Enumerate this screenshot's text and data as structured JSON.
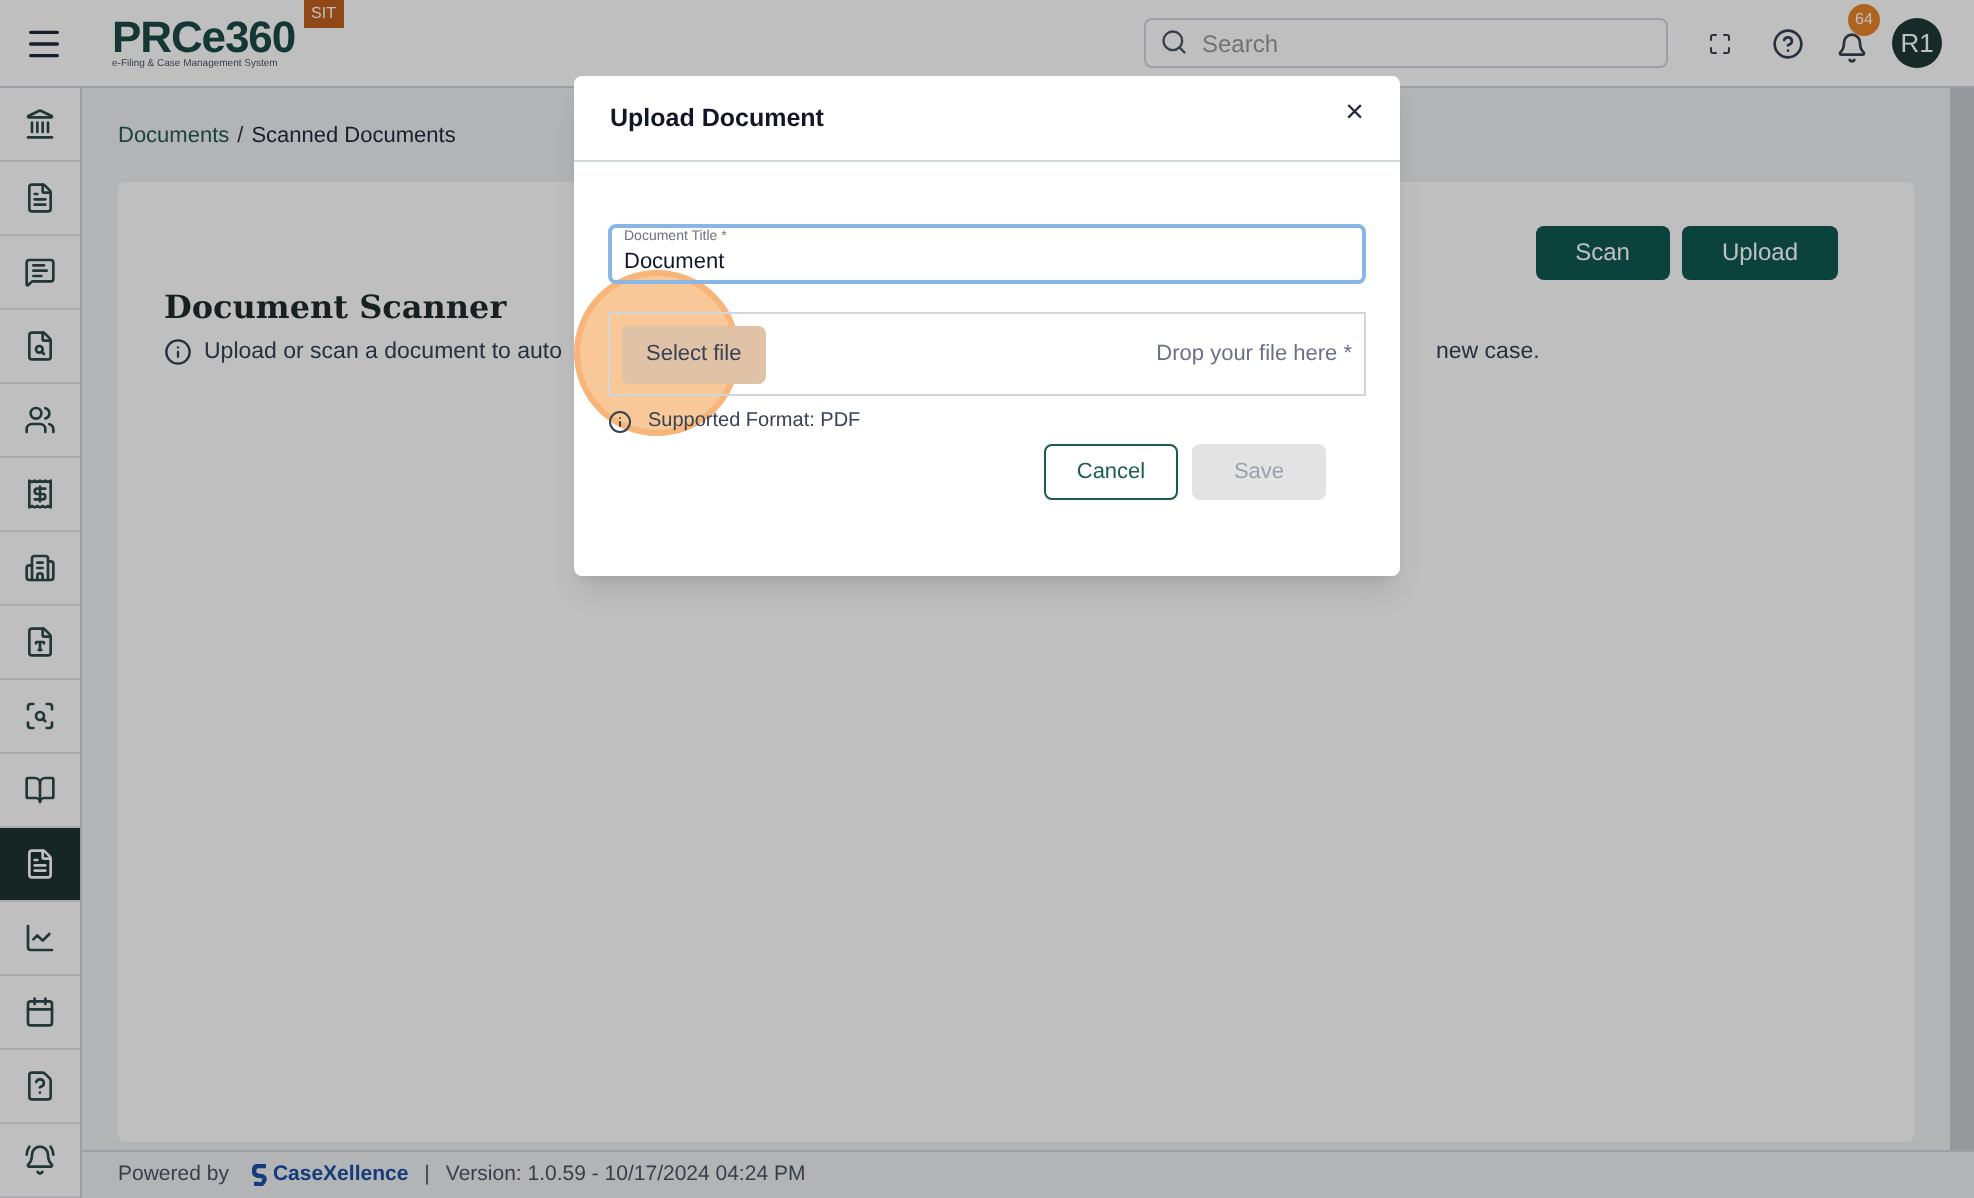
{
  "header": {
    "logo": "PRCe360",
    "logo_subtitle": "e-Filing & Case Management System",
    "env_badge": "SIT",
    "search": {
      "placeholder": "Search"
    },
    "notifications": "64",
    "avatar": "R1"
  },
  "sidebar": {
    "items": [
      {
        "selected": false
      },
      {
        "selected": false
      },
      {
        "selected": false
      },
      {
        "selected": false
      },
      {
        "selected": false
      },
      {
        "selected": false
      },
      {
        "selected": false
      },
      {
        "selected": false
      },
      {
        "selected": false
      },
      {
        "selected": false
      },
      {
        "selected": true
      },
      {
        "selected": false
      },
      {
        "selected": false
      },
      {
        "selected": false
      },
      {
        "selected": false
      }
    ]
  },
  "breadcrumb": {
    "items": [
      "Documents",
      "Scanned Documents"
    ],
    "separator": "/"
  },
  "page": {
    "title": "Document Scanner",
    "description_start": "Upload or scan a document to auto",
    "description_end": "new case.",
    "buttons": [
      "Scan",
      "Upload"
    ]
  },
  "dialog": {
    "title": "Upload Document",
    "close": "×",
    "field": {
      "label": "Document Title *",
      "value": "Document",
      "focused": true
    },
    "select_file": "Select file",
    "drop_hint": "Drop your file here *",
    "format_note": "Supported Format: PDF",
    "cancel": "Cancel",
    "save": {
      "label": "Save",
      "disabled": true
    }
  },
  "footer": {
    "powered_by": "Powered by",
    "brand": "CaseXellence",
    "separator": "|",
    "version": "Version: 1.0.59 - 10/17/2024 04:24 PM"
  }
}
